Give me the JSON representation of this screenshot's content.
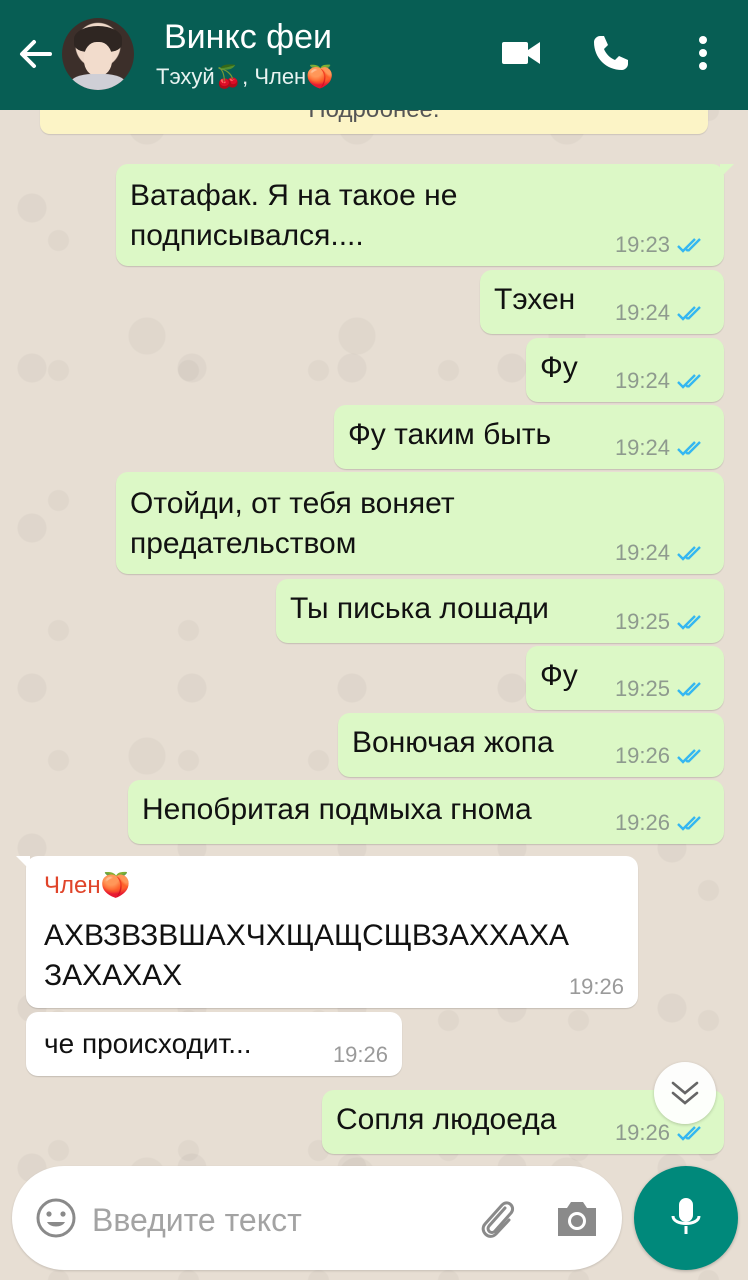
{
  "header": {
    "title": "Винкс феи",
    "subtitle": "Тэхуй🍒, Член🍑"
  },
  "system_note": "Подробнее.",
  "messages": [
    {
      "text": "Ватафак. Я на такое не\nподписывался....",
      "time": "19:23"
    },
    {
      "text": "Тэхен",
      "time": "19:24"
    },
    {
      "text": "Фу",
      "time": "19:24"
    },
    {
      "text": "Фу таким быть",
      "time": "19:24"
    },
    {
      "text": "Отойди, от тебя воняет\nпредательством",
      "time": "19:24"
    },
    {
      "text": "Ты писька лошади",
      "time": "19:25"
    },
    {
      "text": "Фу",
      "time": "19:25"
    },
    {
      "text": "Вонючая жопа",
      "time": "19:26"
    },
    {
      "text": "Непобритая подмыха гнома",
      "time": "19:26"
    },
    {
      "sender": "Член🍑",
      "text": "АХВЗВЗВШАХЧХЩАЩСЩВЗАХХАХА\nЗАХАХАХ",
      "time": "19:26"
    },
    {
      "text": "че происходит...",
      "time": "19:26"
    },
    {
      "text": "Сопля людоеда",
      "time": "19:26"
    }
  ],
  "input": {
    "placeholder": "Введите текст"
  },
  "colors": {
    "header": "#075e54",
    "outgoing_bubble": "#dcf8c6",
    "incoming_bubble": "#ffffff",
    "read_ticks": "#34b7f1",
    "mic_button": "#00897b",
    "sender_name": "#e0442a"
  },
  "icons": [
    "back-arrow-icon",
    "video-call-icon",
    "phone-icon",
    "more-vert-icon",
    "emoji-icon",
    "paperclip-icon",
    "camera-icon",
    "mic-icon",
    "chevron-down-icon",
    "double-check-icon"
  ]
}
